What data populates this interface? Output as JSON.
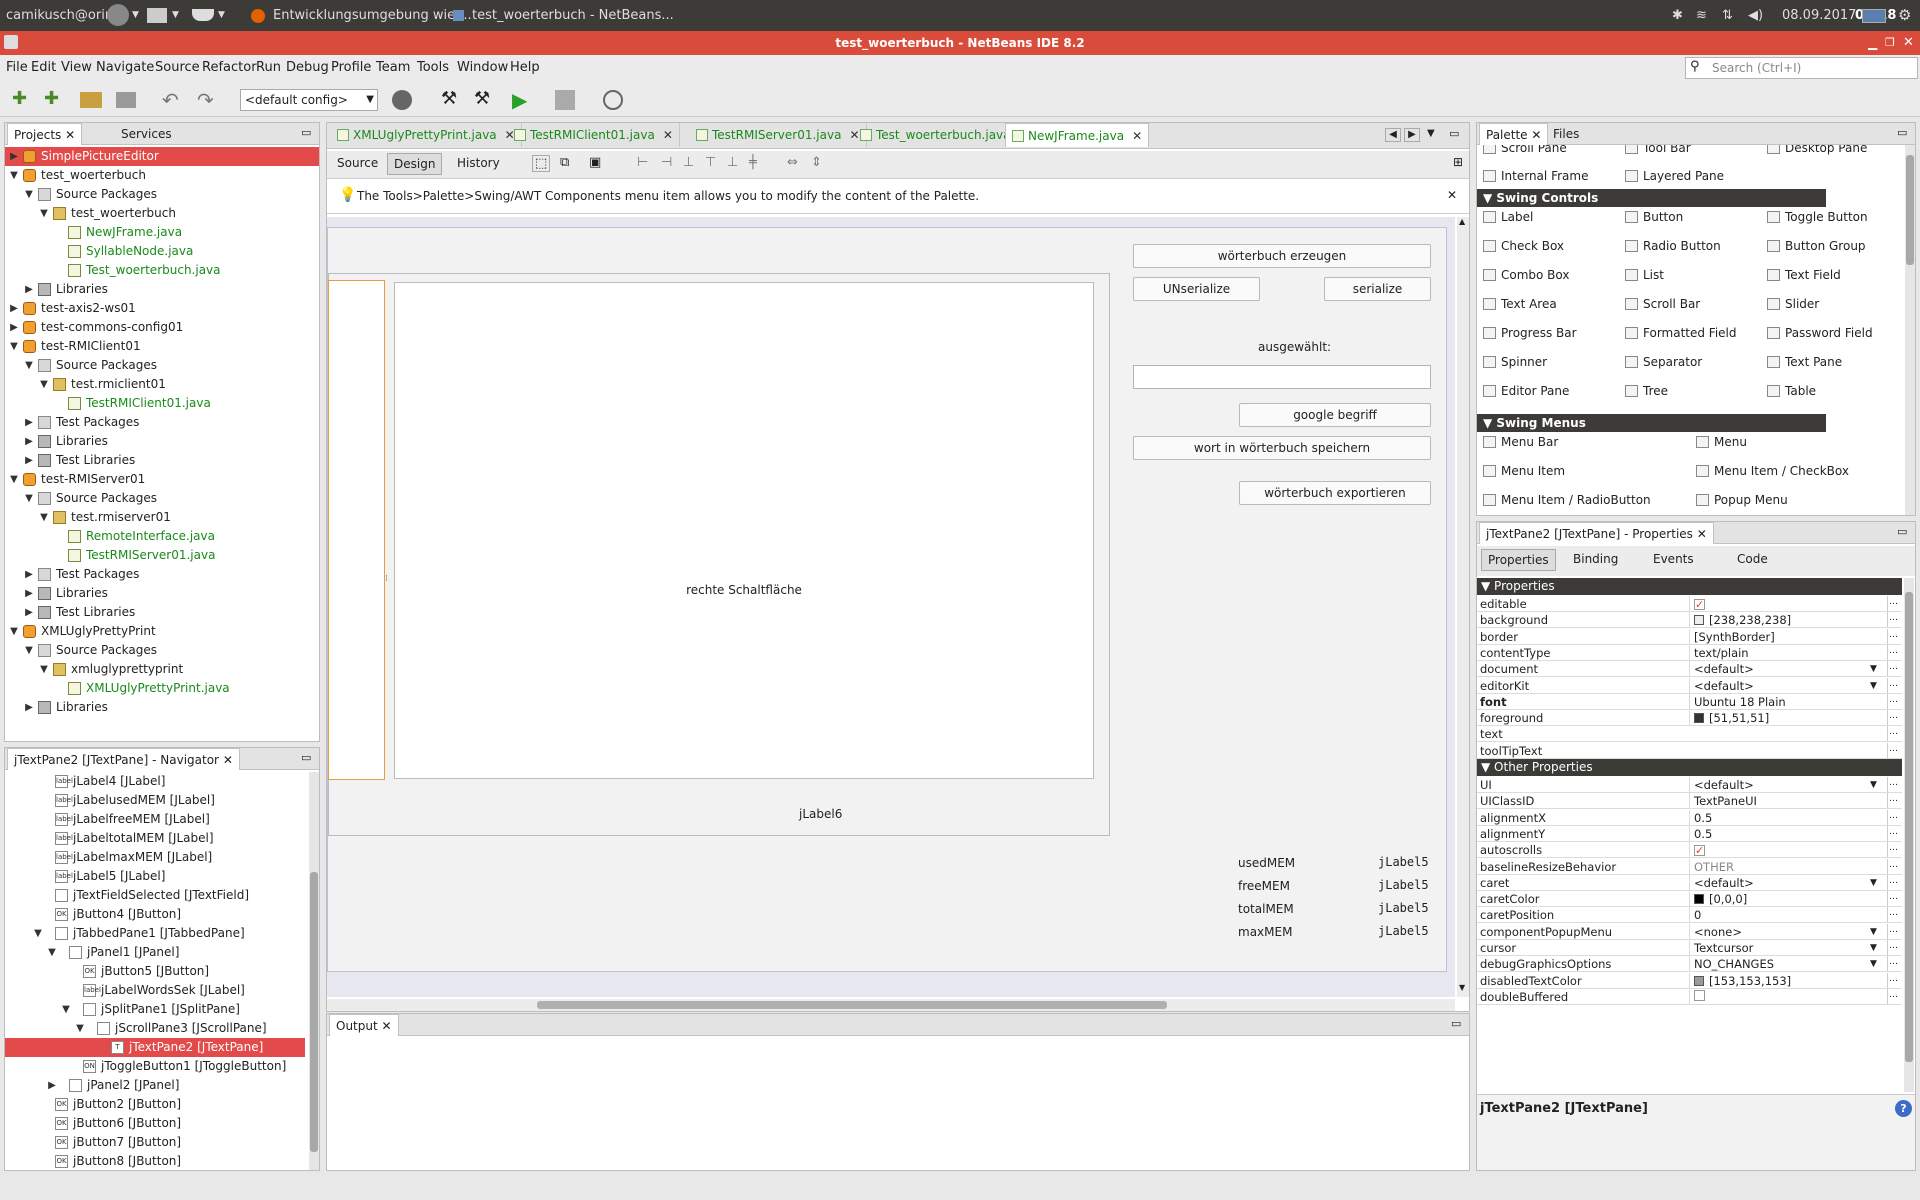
{
  "system_bar": {
    "user": "camikusch@orin",
    "tasks": [
      "Entwicklungsumgebung wie ...",
      "test_woerterbuch - NetBeans..."
    ],
    "date": "08.09.2017",
    "time": "07:18"
  },
  "window": {
    "title": "test_woerterbuch - NetBeans IDE 8.2"
  },
  "menu": [
    "File",
    "Edit",
    "View",
    "Navigate",
    "Source",
    "Refactor",
    "Run",
    "Debug",
    "Profile",
    "Team",
    "Tools",
    "Window",
    "Help"
  ],
  "search": {
    "placeholder": "Search (Ctrl+I)"
  },
  "toolbar": {
    "config": "<default config>"
  },
  "projects_panel": {
    "tabs": [
      "Projects",
      "Services"
    ],
    "tree": [
      {
        "label": "SimplePictureEditor",
        "icon": "project-icon",
        "exp": "▶",
        "indent": 0,
        "selected": true
      },
      {
        "label": "test_woerterbuch",
        "icon": "project-icon",
        "exp": "▼",
        "indent": 0
      },
      {
        "label": "Source Packages",
        "icon": "source-packages-icon",
        "exp": "▼",
        "indent": 1
      },
      {
        "label": "test_woerterbuch",
        "icon": "package-icon",
        "exp": "▼",
        "indent": 2
      },
      {
        "label": "NewJFrame.java",
        "icon": "java-file-icon",
        "exp": "",
        "indent": 3,
        "green": true
      },
      {
        "label": "SyllableNode.java",
        "icon": "java-file-icon",
        "exp": "",
        "indent": 3,
        "green": true
      },
      {
        "label": "Test_woerterbuch.java",
        "icon": "java-file-icon",
        "exp": "",
        "indent": 3,
        "green": true
      },
      {
        "label": "Libraries",
        "icon": "libraries-icon",
        "exp": "▶",
        "indent": 1
      },
      {
        "label": "test-axis2-ws01",
        "icon": "project-icon",
        "exp": "▶",
        "indent": 0
      },
      {
        "label": "test-commons-config01",
        "icon": "project-icon",
        "exp": "▶",
        "indent": 0
      },
      {
        "label": "test-RMIClient01",
        "icon": "project-icon",
        "exp": "▼",
        "indent": 0
      },
      {
        "label": "Source Packages",
        "icon": "source-packages-icon",
        "exp": "▼",
        "indent": 1
      },
      {
        "label": "test.rmiclient01",
        "icon": "package-icon",
        "exp": "▼",
        "indent": 2
      },
      {
        "label": "TestRMIClient01.java",
        "icon": "java-file-icon",
        "exp": "",
        "indent": 3,
        "green": true
      },
      {
        "label": "Test Packages",
        "icon": "source-packages-icon",
        "exp": "▶",
        "indent": 1
      },
      {
        "label": "Libraries",
        "icon": "libraries-icon",
        "exp": "▶",
        "indent": 1
      },
      {
        "label": "Test Libraries",
        "icon": "libraries-icon",
        "exp": "▶",
        "indent": 1
      },
      {
        "label": "test-RMIServer01",
        "icon": "project-icon",
        "exp": "▼",
        "indent": 0
      },
      {
        "label": "Source Packages",
        "icon": "source-packages-icon",
        "exp": "▼",
        "indent": 1
      },
      {
        "label": "test.rmiserver01",
        "icon": "package-icon",
        "exp": "▼",
        "indent": 2
      },
      {
        "label": "RemoteInterface.java",
        "icon": "java-file-icon",
        "exp": "",
        "indent": 3,
        "green": true
      },
      {
        "label": "TestRMIServer01.java",
        "icon": "java-file-icon",
        "exp": "",
        "indent": 3,
        "green": true
      },
      {
        "label": "Test Packages",
        "icon": "source-packages-icon",
        "exp": "▶",
        "indent": 1
      },
      {
        "label": "Libraries",
        "icon": "libraries-icon",
        "exp": "▶",
        "indent": 1
      },
      {
        "label": "Test Libraries",
        "icon": "libraries-icon",
        "exp": "▶",
        "indent": 1
      },
      {
        "label": "XMLUglyPrettyPrint",
        "icon": "project-icon",
        "exp": "▼",
        "indent": 0
      },
      {
        "label": "Source Packages",
        "icon": "source-packages-icon",
        "exp": "▼",
        "indent": 1
      },
      {
        "label": "xmluglyprettyprint",
        "icon": "package-icon",
        "exp": "▼",
        "indent": 2
      },
      {
        "label": "XMLUglyPrettyPrint.java",
        "icon": "java-file-icon",
        "exp": "",
        "indent": 3,
        "green": true
      },
      {
        "label": "Libraries",
        "icon": "libraries-icon",
        "exp": "▶",
        "indent": 1
      }
    ]
  },
  "navigator": {
    "title": "jTextPane2 [JTextPane] - Navigator",
    "tree": [
      {
        "label": "jLabel4 [JLabel]",
        "icon": "label",
        "exp": "",
        "indent": 0
      },
      {
        "label": "jLabelusedMEM [JLabel]",
        "icon": "label",
        "exp": "",
        "indent": 0
      },
      {
        "label": "jLabelfreeMEM [JLabel]",
        "icon": "label",
        "exp": "",
        "indent": 0
      },
      {
        "label": "jLabeltotalMEM [JLabel]",
        "icon": "label",
        "exp": "",
        "indent": 0
      },
      {
        "label": "jLabelmaxMEM [JLabel]",
        "icon": "label",
        "exp": "",
        "indent": 0
      },
      {
        "label": "jLabel5 [JLabel]",
        "icon": "label",
        "exp": "",
        "indent": 0
      },
      {
        "label": "jTextFieldSelected [JTextField]",
        "icon": "",
        "exp": "",
        "indent": 0
      },
      {
        "label": "jButton4 [JButton]",
        "icon": "OK",
        "exp": "",
        "indent": 0
      },
      {
        "label": "jTabbedPane1 [JTabbedPane]",
        "icon": "",
        "exp": "▼",
        "indent": 0
      },
      {
        "label": "jPanel1 [JPanel]",
        "icon": "",
        "exp": "▼",
        "indent": 1
      },
      {
        "label": "jButton5 [JButton]",
        "icon": "OK",
        "exp": "",
        "indent": 2
      },
      {
        "label": "jLabelWordsSek [JLabel]",
        "icon": "label",
        "exp": "",
        "indent": 2
      },
      {
        "label": "jSplitPane1 [JSplitPane]",
        "icon": "",
        "exp": "▼",
        "indent": 2
      },
      {
        "label": "jScrollPane3 [JScrollPane]",
        "icon": "",
        "exp": "▼",
        "indent": 3
      },
      {
        "label": "jTextPane2 [JTextPane]",
        "icon": "T",
        "exp": "",
        "indent": 4,
        "selected": true
      },
      {
        "label": "jToggleButton1 [JToggleButton]",
        "icon": "ON",
        "exp": "",
        "indent": 2
      },
      {
        "label": "jPanel2 [JPanel]",
        "icon": "",
        "exp": "▶",
        "indent": 1
      },
      {
        "label": "jButton2 [JButton]",
        "icon": "OK",
        "exp": "",
        "indent": 0
      },
      {
        "label": "jButton6 [JButton]",
        "icon": "OK",
        "exp": "",
        "indent": 0
      },
      {
        "label": "jButton7 [JButton]",
        "icon": "OK",
        "exp": "",
        "indent": 0
      },
      {
        "label": "jButton8 [JButton]",
        "icon": "OK",
        "exp": "",
        "indent": 0
      }
    ]
  },
  "editor": {
    "tabs": [
      {
        "label": "XMLUglyPrettyPrint.java",
        "active": false
      },
      {
        "label": "TestRMIClient01.java",
        "active": false
      },
      {
        "label": "TestRMIServer01.java",
        "active": false
      },
      {
        "label": "Test_woerterbuch.java",
        "active": false
      },
      {
        "label": "NewJFrame.java",
        "active": true
      }
    ],
    "modes": [
      "Source",
      "Design",
      "History"
    ],
    "hint": "The Tools>Palette>Swing/AWT Components menu item allows you to modify the content of the Palette."
  },
  "form": {
    "btn_create": "wörterbuch erzeugen",
    "btn_unserialize": "UNserialize",
    "btn_serialize": "serialize",
    "selected_label": "ausgewählt:",
    "btn_google": "google begriff",
    "btn_save_word": "wort in wörterbuch speichern",
    "btn_export": "wörterbuch exportieren",
    "right_button": "rechte Schaltfläche",
    "jlabel6": "jLabel6",
    "mem_labels": [
      "usedMEM",
      "freeMEM",
      "totalMEM",
      "maxMEM"
    ],
    "mem_values": [
      "jLabel5",
      "jLabel5",
      "jLabel5",
      "jLabel5"
    ]
  },
  "output": {
    "tab": "Output"
  },
  "palette": {
    "tabs": [
      "Palette",
      "Files"
    ],
    "top_items": [
      "Scroll Pane",
      "Tool Bar",
      "Desktop Pane",
      "Internal Frame",
      "Layered Pane"
    ],
    "swing_controls_title": "Swing Controls",
    "swing_controls": [
      "Label",
      "Button",
      "Toggle Button",
      "Check Box",
      "Radio Button",
      "Button Group",
      "Combo Box",
      "List",
      "Text Field",
      "Text Area",
      "Scroll Bar",
      "Slider",
      "Progress Bar",
      "Formatted Field",
      "Password Field",
      "Spinner",
      "Separator",
      "Text Pane",
      "Editor Pane",
      "Tree",
      "Table"
    ],
    "swing_menus_title": "Swing Menus",
    "swing_menus": [
      "Menu Bar",
      "Menu",
      "Menu Item",
      "Menu Item / CheckBox",
      "Menu Item / RadioButton",
      "Popup Menu"
    ]
  },
  "properties": {
    "title": "jTextPane2 [JTextPane] - Properties",
    "tabs": [
      "Properties",
      "Binding",
      "Events",
      "Code"
    ],
    "section1": "Properties",
    "rows1": [
      {
        "name": "editable",
        "value": "",
        "check": true
      },
      {
        "name": "background",
        "value": "[238,238,238]",
        "swatch": "#eeeeee"
      },
      {
        "name": "border",
        "value": "[SynthBorder]"
      },
      {
        "name": "contentType",
        "value": "text/plain"
      },
      {
        "name": "document",
        "value": "<default>",
        "dropdown": true
      },
      {
        "name": "editorKit",
        "value": "<default>",
        "dropdown": true
      },
      {
        "name": "font",
        "value": "Ubuntu 18 Plain",
        "bold": true
      },
      {
        "name": "foreground",
        "value": "[51,51,51]",
        "swatch": "#333333"
      },
      {
        "name": "text",
        "value": ""
      },
      {
        "name": "toolTipText",
        "value": ""
      }
    ],
    "section2": "Other Properties",
    "rows2": [
      {
        "name": "UI",
        "value": "<default>",
        "dropdown": true
      },
      {
        "name": "UIClassID",
        "value": "TextPaneUI"
      },
      {
        "name": "alignmentX",
        "value": "0.5"
      },
      {
        "name": "alignmentY",
        "value": "0.5"
      },
      {
        "name": "autoscrolls",
        "value": "",
        "check": true
      },
      {
        "name": "baselineResizeBehavior",
        "value": "OTHER"
      },
      {
        "name": "caret",
        "value": "<default>",
        "dropdown": true
      },
      {
        "name": "caretColor",
        "value": "[0,0,0]",
        "swatch": "#000000"
      },
      {
        "name": "caretPosition",
        "value": "0"
      },
      {
        "name": "componentPopupMenu",
        "value": "<none>",
        "dropdown": true
      },
      {
        "name": "cursor",
        "value": "Textcursor",
        "dropdown": true
      },
      {
        "name": "debugGraphicsOptions",
        "value": "NO_CHANGES",
        "dropdown": true
      },
      {
        "name": "disabledTextColor",
        "value": "[153,153,153]",
        "swatch": "#999999"
      },
      {
        "name": "doubleBuffered",
        "value": "",
        "emptycheck": true
      }
    ],
    "footer": "jTextPane2 [JTextPane]"
  }
}
